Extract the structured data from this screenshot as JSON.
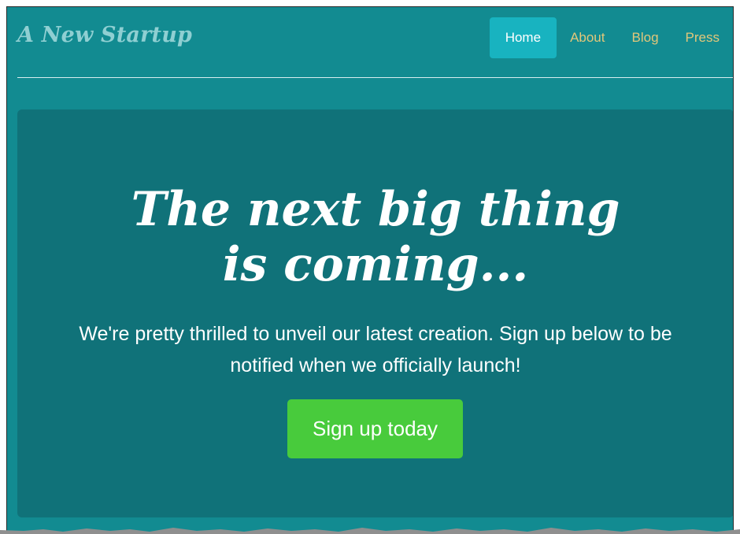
{
  "header": {
    "brand": "A New Startup",
    "nav": [
      {
        "label": "Home",
        "active": true
      },
      {
        "label": "About",
        "active": false
      },
      {
        "label": "Blog",
        "active": false
      },
      {
        "label": "Press",
        "active": false
      }
    ]
  },
  "hero": {
    "title": "The next big thing is coming...",
    "text": "We're pretty thrilled to unveil our latest creation. Sign up below to be notified when we officially launch!",
    "cta_label": "Sign up today"
  },
  "colors": {
    "page_background": "#128b91",
    "hero_background": "#107279",
    "nav_active": "#18b3c0",
    "nav_link": "#e2c77a",
    "cta": "#48cb3c"
  }
}
